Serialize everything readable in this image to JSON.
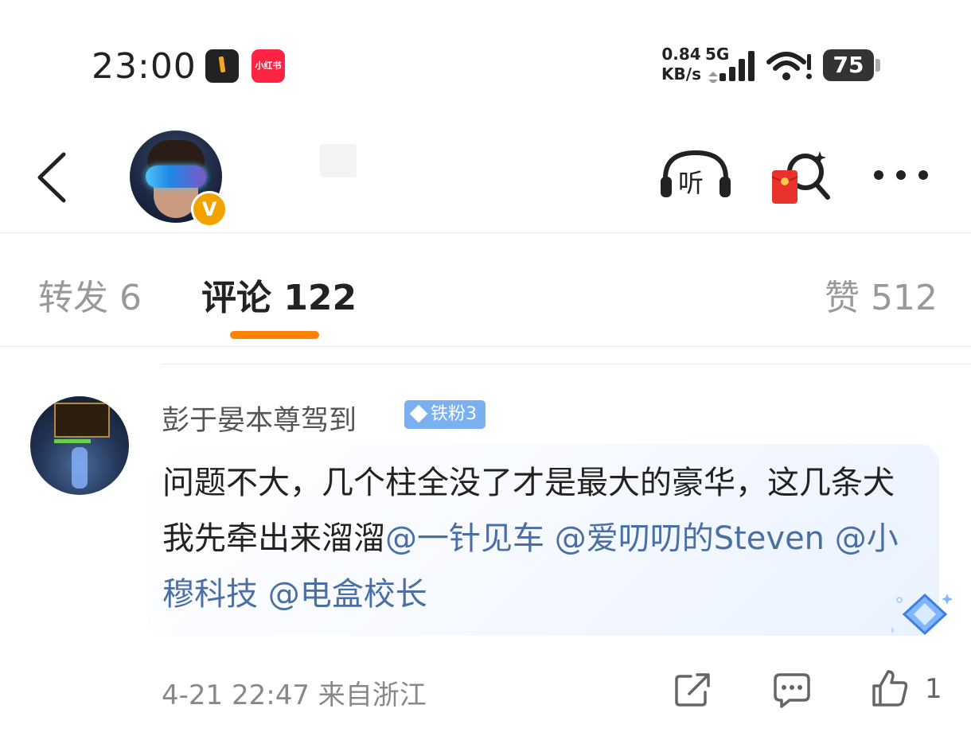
{
  "status_bar": {
    "time": "23:00",
    "app_icons": [
      "clock-app-icon",
      "xiaohongshu-app-icon"
    ],
    "xiaohongshu_label": "小红书",
    "net_speed_value": "0.84",
    "net_speed_unit": "KB/s",
    "net_type": "5G",
    "battery": "75"
  },
  "header": {
    "avatar_icon": "avatar-vr-headset",
    "verified_badge": "V",
    "listen_label": "听",
    "icons": [
      "back-icon",
      "listen-headphones-icon",
      "red-packet-search-icon",
      "more-icon"
    ]
  },
  "tabs": {
    "repost": "转发 6",
    "comments": "评论 122",
    "likes": "赞 512",
    "active": "comments",
    "accent_color": "#ff8200"
  },
  "comment": {
    "username": "彭于晏本尊驾到",
    "fan_badge": "铁粉3",
    "text_plain": "问题不大，几个柱全没了才是最大的豪华，这几条犬我先牵出来溜溜",
    "mentions": [
      "@一针见车",
      "@爱叨叨的Steven",
      "@小穆科技",
      "@电盒校长"
    ],
    "time": "4-21 22:47",
    "location": "来自浙江",
    "like_count": "1",
    "mention_color": "#4a6fa5"
  }
}
